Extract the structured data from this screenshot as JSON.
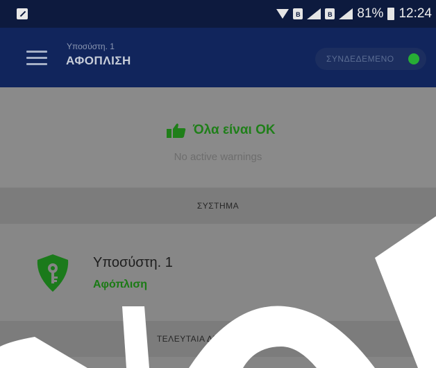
{
  "statusbar": {
    "battery_percent": "81%",
    "time": "12:24",
    "sim_label": "B"
  },
  "appbar": {
    "subtitle": "Υποσύστη. 1",
    "title": "ΑΦΟΠΛΙΣΗ",
    "connection_label": "ΣΥΝΔΕΔΕΜΕΝΟ",
    "connection_color": "#27ad35"
  },
  "status": {
    "title": "Όλα είναι ΟΚ",
    "subtitle": "No active warnings",
    "accent_color": "#1f7f19"
  },
  "sections": {
    "system_header": "ΣΥΣΤΗΜΑ",
    "activity_header": "ΤΕΛΕΥΤΑΙΑ ΔΡΑΣΤΗΡΙΟΤΗΤΑ"
  },
  "system": {
    "name": "Υποσύστη. 1",
    "state": "Αφόπλιση",
    "icon": "shield-key-icon"
  }
}
